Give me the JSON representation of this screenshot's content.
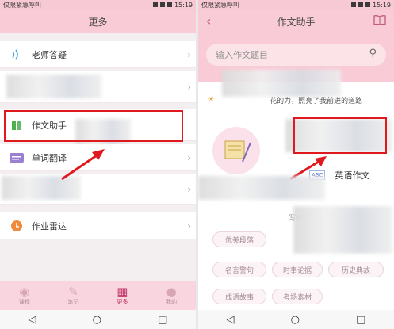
{
  "status_bar": {
    "carrier": "仅限紧急呼叫",
    "time": "15:19"
  },
  "left_screen": {
    "title": "更多",
    "menu_items": [
      {
        "label": "老师答疑",
        "icon": "wave-icon"
      },
      {
        "label": "作文助手",
        "icon": "book-icon"
      },
      {
        "label": "单词翻译",
        "icon": "abc-icon"
      },
      {
        "label": "作业雷达",
        "icon": "radar-icon"
      }
    ],
    "bottom_nav": [
      {
        "label": "课程"
      },
      {
        "label": "笔记"
      },
      {
        "label": "更多"
      },
      {
        "label": "我的"
      }
    ]
  },
  "right_screen": {
    "title": "作文助手",
    "search": {
      "placeholder": "输入作文题目"
    },
    "quote_text": "花的力，照亮了我前进的道路",
    "english_composition": "英语作文",
    "section_title": "写作",
    "tags": [
      "优美段落",
      "名言警句",
      "时事论据",
      "历史典故",
      "成语故事",
      "考场素材"
    ]
  },
  "colors": {
    "accent": "#f8cbd6",
    "highlight_box": "#e0191e",
    "brand_text": "#c45a7a"
  }
}
